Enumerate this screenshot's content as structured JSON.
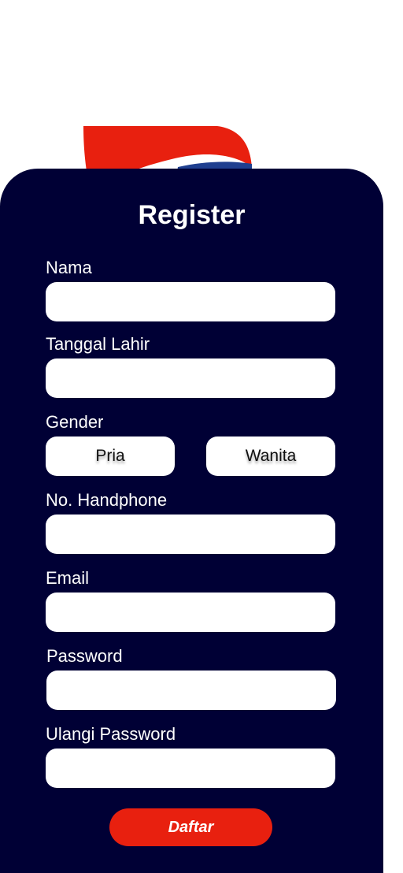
{
  "brand_colors": {
    "red": "#e8200f",
    "blue": "#1f3f8f",
    "card_background": "#000035"
  },
  "logo": {
    "icon": "brand-logo-icon"
  },
  "form": {
    "title": "Register",
    "fields": {
      "nama": {
        "label": "Nama",
        "value": ""
      },
      "tanggal_lahir": {
        "label": "Tanggal Lahir",
        "value": ""
      },
      "no_handphone": {
        "label": "No. Handphone",
        "value": ""
      },
      "email": {
        "label": "Email",
        "value": ""
      },
      "password": {
        "label": "Password",
        "value": ""
      },
      "ulangi_password": {
        "label": "Ulangi Password",
        "value": ""
      }
    },
    "gender": {
      "label": "Gender",
      "options": [
        "Pria",
        "Wanita"
      ]
    },
    "submit_label": "Daftar"
  }
}
